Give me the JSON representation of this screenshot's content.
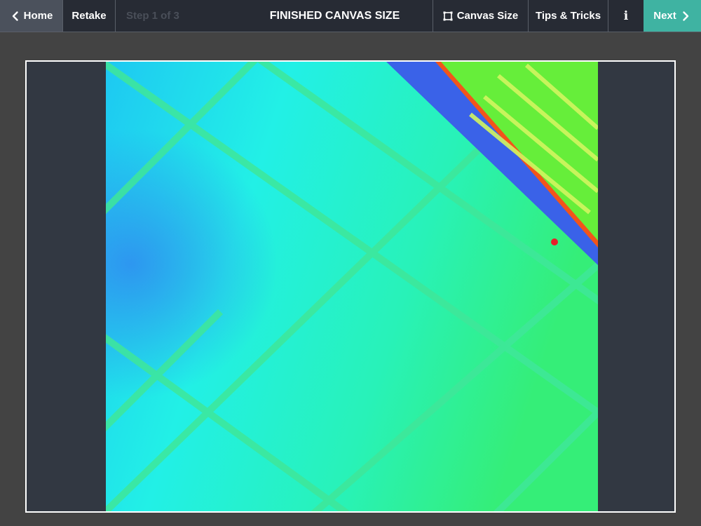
{
  "toolbar": {
    "home_label": "Home",
    "retake_label": "Retake",
    "step_label": "Step 1 of 3",
    "title": "FINISHED CANVAS SIZE",
    "canvas_size_label": "Canvas Size",
    "tips_label": "Tips & Tricks",
    "info_label": "i",
    "next_label": "Next"
  },
  "icons": {
    "back": "chevron-left-icon",
    "crop": "crop-square-icon",
    "info": "info-icon",
    "forward": "chevron-right-icon"
  },
  "colors": {
    "toolbar_bg": "#272b34",
    "home_bg": "#4b515c",
    "next_bg": "#3fb3a2",
    "step_disabled": "#4a4f59",
    "page_bg": "#434343",
    "frame_bg": "#323842"
  }
}
